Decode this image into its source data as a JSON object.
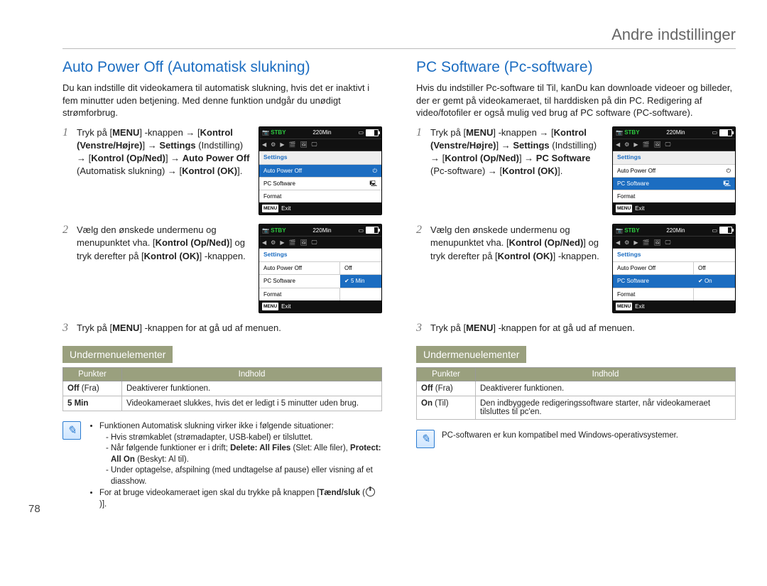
{
  "page_number": "78",
  "header": "Andre indstillinger",
  "left": {
    "title": "Auto Power Off (Automatisk slukning)",
    "intro": "Du kan indstille dit videokamera til automatisk slukning, hvis det er inaktivt i fem minutter uden betjening. Med denne funktion undgår du unødigt strømforbrug.",
    "step1_pre": "Tryk på [",
    "step1_menu": "MENU",
    "step1_mid1": "] -knappen → [",
    "step1_kv": "Kontrol (Venstre/Højre)",
    "step1_mid2": "] → ",
    "step1_set": "Settings",
    "step1_mid3": " (Indstilling) → [",
    "step1_kud": "Kontrol (Op/Ned)",
    "step1_mid4": "] → ",
    "step1_apo": "Auto Power Off",
    "step1_mid5": " (Automatisk slukning) → [",
    "step1_kok": "Kontrol (OK)",
    "step1_end": "].",
    "step2_pre": "Vælg den ønskede undermenu og menupunktet vha. [",
    "step2_kud": "Kontrol (Op/Ned)",
    "step2_mid": "] og tryk derefter på [",
    "step2_kok": "Kontrol (OK)",
    "step2_end": "] -knappen.",
    "step3_pre": "Tryk på [",
    "step3_menu": "MENU",
    "step3_end": "] -knappen for at gå ud af menuen.",
    "sub_heading": "Undermenuelementer",
    "table": {
      "h1": "Punkter",
      "h2": "Indhold",
      "rows": [
        {
          "k": "Off (Fra)",
          "k_bold": "Off",
          "k_rest": " (Fra)",
          "v": "Deaktiverer funktionen."
        },
        {
          "k": "5 Min",
          "k_bold": "5 Min",
          "k_rest": "",
          "v": "Videokameraet slukkes, hvis det er ledigt i 5 minutter uden brug."
        }
      ]
    },
    "notes": {
      "b1": "Funktionen Automatisk slukning virker ikke i følgende situationer:",
      "s1": "Hvis strømkablet (strømadapter, USB-kabel) er tilsluttet.",
      "s2_pre": "Når følgende funktioner er i drift; ",
      "s2_b1": "Delete: All Files",
      "s2_mid": " (Slet: Alle filer), ",
      "s2_b2": "Protect: All On",
      "s2_end": " (Beskyt: Al til).",
      "s3": "Under optagelse, afspilning (med undtagelse af pause) eller visning af et diasshow.",
      "b2_pre": "For at bruge videokameraet igen skal du trykke på knappen [",
      "b2_b": "Tænd/sluk",
      "b2_post": " (",
      "b2_end": ")]."
    },
    "screen1": {
      "stby": "STBY",
      "time": "220Min",
      "title": "Settings",
      "items": [
        "Auto Power Off",
        "PC Software",
        "Format"
      ],
      "exit": "Exit",
      "menu": "MENU"
    },
    "screen2": {
      "stby": "STBY",
      "time": "220Min",
      "title": "Settings",
      "rows": [
        {
          "l": "Auto Power Off",
          "r": "Off"
        },
        {
          "l": "PC Software",
          "r": "5 Min"
        },
        {
          "l": "Format",
          "r": ""
        }
      ],
      "exit": "Exit",
      "menu": "MENU"
    }
  },
  "right": {
    "title": "PC Software (Pc-software)",
    "intro": "Hvis du indstiller Pc-software til Til, kanDu kan downloade videoer og billeder, der er gemt på videokameraet, til harddisken på din PC. Redigering af video/fotofiler er også mulig ved brug af PC software (PC-software).",
    "step1_pre": "Tryk på [",
    "step1_menu": "MENU",
    "step1_mid1": "] -knappen → [",
    "step1_kv": "Kontrol (Venstre/Højre)",
    "step1_mid2": "] → ",
    "step1_set": "Settings",
    "step1_mid3": " (Indstilling) → [",
    "step1_kud": "Kontrol (Op/Ned)",
    "step1_mid4": "] → ",
    "step1_pcs": "PC Software",
    "step1_mid5": " (Pc-software) → [",
    "step1_kok": "Kontrol (OK)",
    "step1_end": "].",
    "step2_pre": "Vælg den ønskede undermenu og menupunktet vha. [",
    "step2_kud": "Kontrol (Op/Ned)",
    "step2_mid": "] og tryk derefter på [",
    "step2_kok": "Kontrol (OK)",
    "step2_end": "] -knappen.",
    "step3_pre": "Tryk på [",
    "step3_menu": "MENU",
    "step3_end": "] -knappen for at gå ud af menuen.",
    "sub_heading": "Undermenuelementer",
    "table": {
      "h1": "Punkter",
      "h2": "Indhold",
      "rows": [
        {
          "k_bold": "Off",
          "k_rest": " (Fra)",
          "v": "Deaktiverer funktionen."
        },
        {
          "k_bold": "On",
          "k_rest": " (Til)",
          "v": "Den indbyggede redigeringssoftware starter, når videokameraet tilsluttes til pc'en."
        }
      ]
    },
    "note_text": "PC-softwaren er kun kompatibel med Windows-operativsystemer.",
    "screen1": {
      "stby": "STBY",
      "time": "220Min",
      "title": "Settings",
      "items": [
        "Auto Power Off",
        "PC Software",
        "Format"
      ],
      "exit": "Exit",
      "menu": "MENU"
    },
    "screen2": {
      "stby": "STBY",
      "time": "220Min",
      "title": "Settings",
      "rows": [
        {
          "l": "Auto Power Off",
          "r": "Off"
        },
        {
          "l": "PC Software",
          "r": "On"
        },
        {
          "l": "Format",
          "r": ""
        }
      ],
      "exit": "Exit",
      "menu": "MENU"
    }
  }
}
